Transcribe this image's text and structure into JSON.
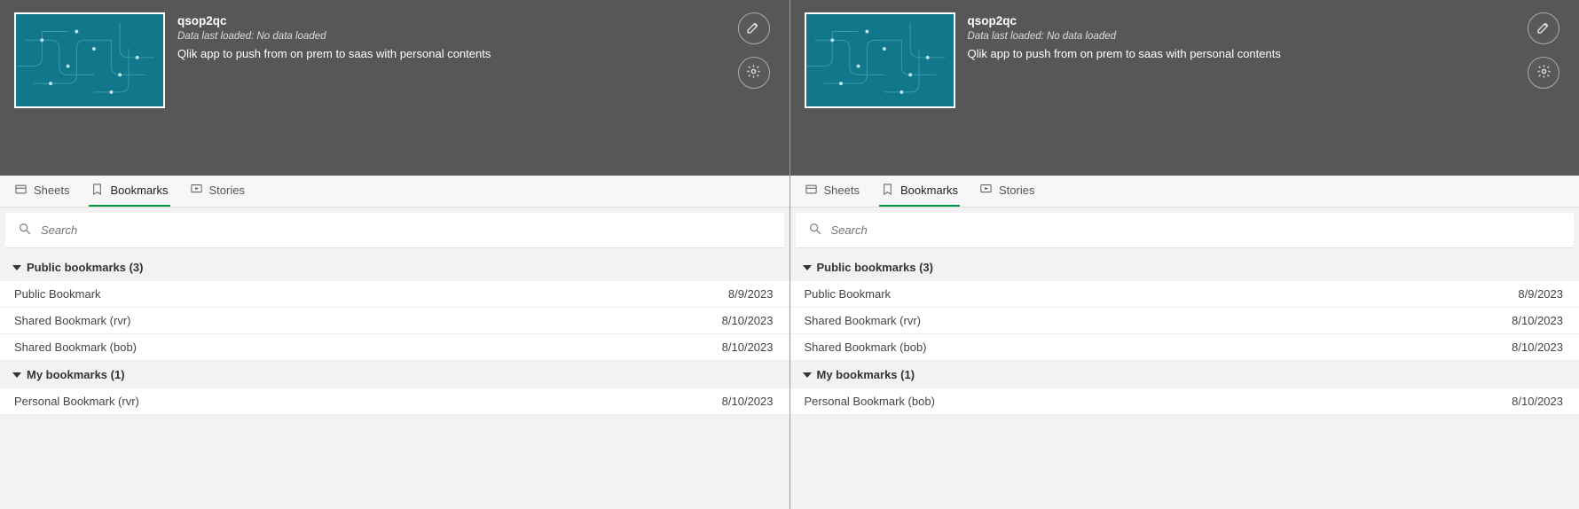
{
  "panes": [
    {
      "app": {
        "name": "qsop2qc",
        "last_loaded": "Data last loaded: No data loaded",
        "description": "Qlik app to push from on prem to saas with personal contents"
      },
      "tabs": [
        {
          "label": "Sheets",
          "active": false,
          "icon": "sheets"
        },
        {
          "label": "Bookmarks",
          "active": true,
          "icon": "bookmark"
        },
        {
          "label": "Stories",
          "active": false,
          "icon": "stories"
        }
      ],
      "search_placeholder": "Search",
      "sections": [
        {
          "title": "Public bookmarks (3)",
          "items": [
            {
              "name": "Public Bookmark",
              "date": "8/9/2023"
            },
            {
              "name": "Shared Bookmark (rvr)",
              "date": "8/10/2023"
            },
            {
              "name": "Shared Bookmark (bob)",
              "date": "8/10/2023"
            }
          ]
        },
        {
          "title": "My bookmarks (1)",
          "items": [
            {
              "name": "Personal Bookmark (rvr)",
              "date": "8/10/2023"
            }
          ]
        }
      ]
    },
    {
      "app": {
        "name": "qsop2qc",
        "last_loaded": "Data last loaded: No data loaded",
        "description": "Qlik app to push from on prem to saas with personal contents"
      },
      "tabs": [
        {
          "label": "Sheets",
          "active": false,
          "icon": "sheets"
        },
        {
          "label": "Bookmarks",
          "active": true,
          "icon": "bookmark"
        },
        {
          "label": "Stories",
          "active": false,
          "icon": "stories"
        }
      ],
      "search_placeholder": "Search",
      "sections": [
        {
          "title": "Public bookmarks (3)",
          "items": [
            {
              "name": "Public Bookmark",
              "date": "8/9/2023"
            },
            {
              "name": "Shared Bookmark (rvr)",
              "date": "8/10/2023"
            },
            {
              "name": "Shared Bookmark (bob)",
              "date": "8/10/2023"
            }
          ]
        },
        {
          "title": "My bookmarks (1)",
          "items": [
            {
              "name": "Personal Bookmark (bob)",
              "date": "8/10/2023"
            }
          ]
        }
      ]
    }
  ]
}
